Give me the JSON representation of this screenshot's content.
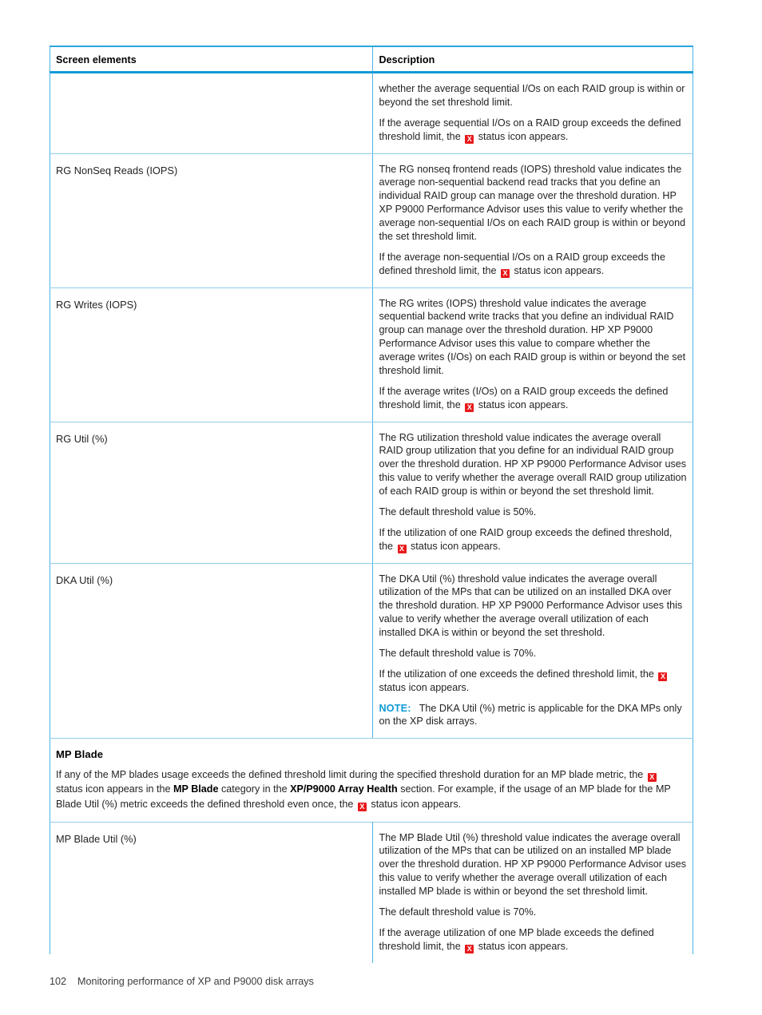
{
  "table": {
    "headers": {
      "screen_elements": "Screen elements",
      "description": "Description"
    },
    "rows": [
      {
        "term": "",
        "paragraphs": [
          "whether the average sequential I/Os on each RAID group is within or beyond the set threshold limit.",
          "If the average sequential I/Os on a RAID group exceeds the defined threshold limit, the {X} status icon appears."
        ]
      },
      {
        "term": "RG NonSeq Reads (IOPS)",
        "paragraphs": [
          "The RG nonseq frontend reads (IOPS) threshold value indicates the average non-sequential backend read tracks that you define an individual RAID group can manage over the threshold duration. HP XP P9000 Performance Advisor uses this value to verify whether the average non-sequential I/Os on each RAID group is within or beyond the set threshold limit.",
          "If the average non-sequential I/Os on a RAID group exceeds the defined threshold limit, the {X} status icon appears."
        ]
      },
      {
        "term": "RG Writes (IOPS)",
        "paragraphs": [
          "The RG writes (IOPS) threshold value indicates the average sequential backend write tracks that you define an individual RAID group can manage over the threshold duration. HP XP P9000 Performance Advisor uses this value to compare whether the average writes (I/Os) on each RAID group is within or beyond the set threshold limit.",
          "If the average writes (I/Os) on a RAID group exceeds the defined threshold limit, the {X} status icon appears."
        ]
      },
      {
        "term": "RG Util (%)",
        "paragraphs": [
          "The RG utilization threshold value indicates the average overall RAID group utilization that you define for an individual RAID group over the threshold duration. HP XP P9000 Performance Advisor uses this value to verify whether the average overall RAID group utilization of each RAID group is within or beyond the set threshold limit.",
          "The default threshold value is 50%.",
          "If the utilization of one RAID group exceeds the defined threshold, the {X} status icon appears."
        ]
      },
      {
        "term": "DKA Util (%)",
        "paragraphs": [
          "The DKA Util (%) threshold value indicates the average overall utilization of the MPs that can be utilized on an installed DKA over the threshold duration. HP XP P9000 Performance Advisor uses this value to verify whether the average overall utilization of each installed DKA is within or beyond the set threshold.",
          "The default threshold value is 70%.",
          "If the utilization of one exceeds the defined threshold limit, the {X} status icon appears."
        ],
        "note": {
          "label": "NOTE:",
          "text": "The DKA Util (%) metric is applicable for the DKA MPs only on the XP disk arrays."
        }
      }
    ],
    "banner": {
      "title": "MP Blade",
      "body_parts": [
        {
          "type": "text",
          "value": "If any of the MP blades usage exceeds the defined threshold limit during the specified threshold duration for an MP blade metric, the "
        },
        {
          "type": "icon",
          "value": "status-error-icon"
        },
        {
          "type": "text",
          "value": " status icon appears in the "
        },
        {
          "type": "bold",
          "value": "MP Blade"
        },
        {
          "type": "text",
          "value": " category in the "
        },
        {
          "type": "bold",
          "value": "XP/P9000 Array Health"
        },
        {
          "type": "text",
          "value": " section. For example, if the usage of an MP blade for the MP Blade Util (%) metric exceeds the defined threshold even once, the "
        },
        {
          "type": "icon",
          "value": "status-error-icon"
        },
        {
          "type": "text",
          "value": " status icon appears."
        }
      ]
    },
    "rows_after_banner": [
      {
        "term": "MP Blade Util (%)",
        "paragraphs": [
          "The MP Blade Util (%) threshold value indicates the average overall utilization of the MPs that can be utilized on an installed MP blade over the threshold duration. HP XP P9000 Performance Advisor uses this value to verify whether the average overall utilization of each installed MP blade is within or beyond the set threshold limit.",
          "The default threshold value is 70%.",
          "If the average utilization of one MP blade exceeds the defined threshold limit, the {X} status icon appears."
        ]
      }
    ]
  },
  "icons": {
    "status_error": {
      "name": "status-error-icon",
      "glyph": "X",
      "background": "#e8191b",
      "foreground": "#ffffff"
    }
  },
  "footer": {
    "page_number": "102",
    "chapter_title": "Monitoring performance of XP and P9000 disk arrays"
  },
  "colors": {
    "rule_primary": "#0f9bd7",
    "rule_secondary": "#8fcdea",
    "border_vertical": "#4ab3e3",
    "note_label": "#0e9ad6",
    "text": "#231f20"
  }
}
